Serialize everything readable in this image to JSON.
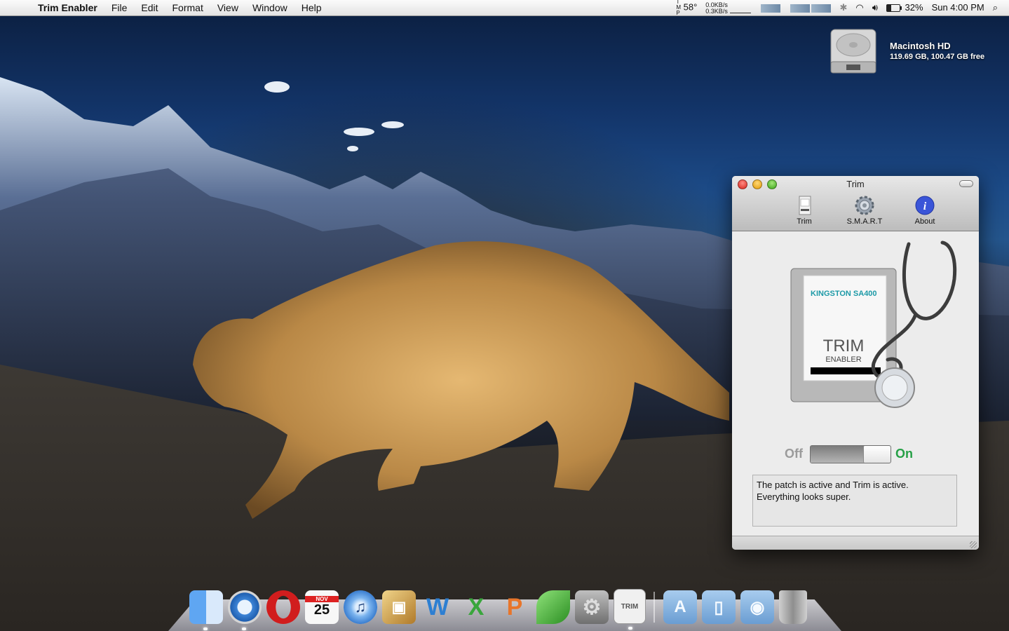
{
  "menubar": {
    "apple_icon": "apple-icon",
    "app_name": "Trim Enabler",
    "menus": [
      "File",
      "Edit",
      "Format",
      "View",
      "Window",
      "Help"
    ],
    "status": {
      "temp_label": "T\nM\nP",
      "temperature": "58°",
      "net_up": "0.0KB/s",
      "net_down": "0.3KB/s",
      "battery_percent": "32%",
      "clock": "Sun 4:00 PM"
    }
  },
  "desktop": {
    "drive_name": "Macintosh HD",
    "drive_info": "119.69 GB, 100.47 GB free"
  },
  "window": {
    "title": "Trim",
    "tabs": [
      {
        "label": "Trim",
        "icon": "ssd-icon"
      },
      {
        "label": "S.M.A.R.T",
        "icon": "gear-icon"
      },
      {
        "label": "About",
        "icon": "info-icon"
      }
    ],
    "hero": {
      "brand": "KINGSTON SA400",
      "title": "TRIM",
      "subtitle": "ENABLER"
    },
    "switch": {
      "off_label": "Off",
      "on_label": "On",
      "state": "on"
    },
    "status_text_line1": "The patch is active and Trim is active.",
    "status_text_line2": "Everything looks super."
  },
  "dock": {
    "items": [
      {
        "name": "finder",
        "color": "#3b7ed6"
      },
      {
        "name": "safari",
        "color": "#2f7fd3"
      },
      {
        "name": "opera",
        "color": "#d11d1d"
      },
      {
        "name": "ical",
        "color": "#f4f4f4",
        "text": "25",
        "month": "NOV"
      },
      {
        "name": "itunes",
        "color": "#6aa6e6"
      },
      {
        "name": "iphoto",
        "color": "#c89b3a"
      },
      {
        "name": "word",
        "color": "#2d7fd2"
      },
      {
        "name": "excel",
        "color": "#39a63c"
      },
      {
        "name": "powerpoint",
        "color": "#e8752a"
      },
      {
        "name": "leaf-app",
        "color": "#46b33a"
      },
      {
        "name": "system-preferences",
        "color": "#8c8c8c"
      },
      {
        "name": "trim-enabler",
        "color": "#e8e8e8"
      }
    ],
    "folders": [
      "applications-folder",
      "documents-folder",
      "downloads-folder"
    ],
    "trash": "trash-icon"
  }
}
